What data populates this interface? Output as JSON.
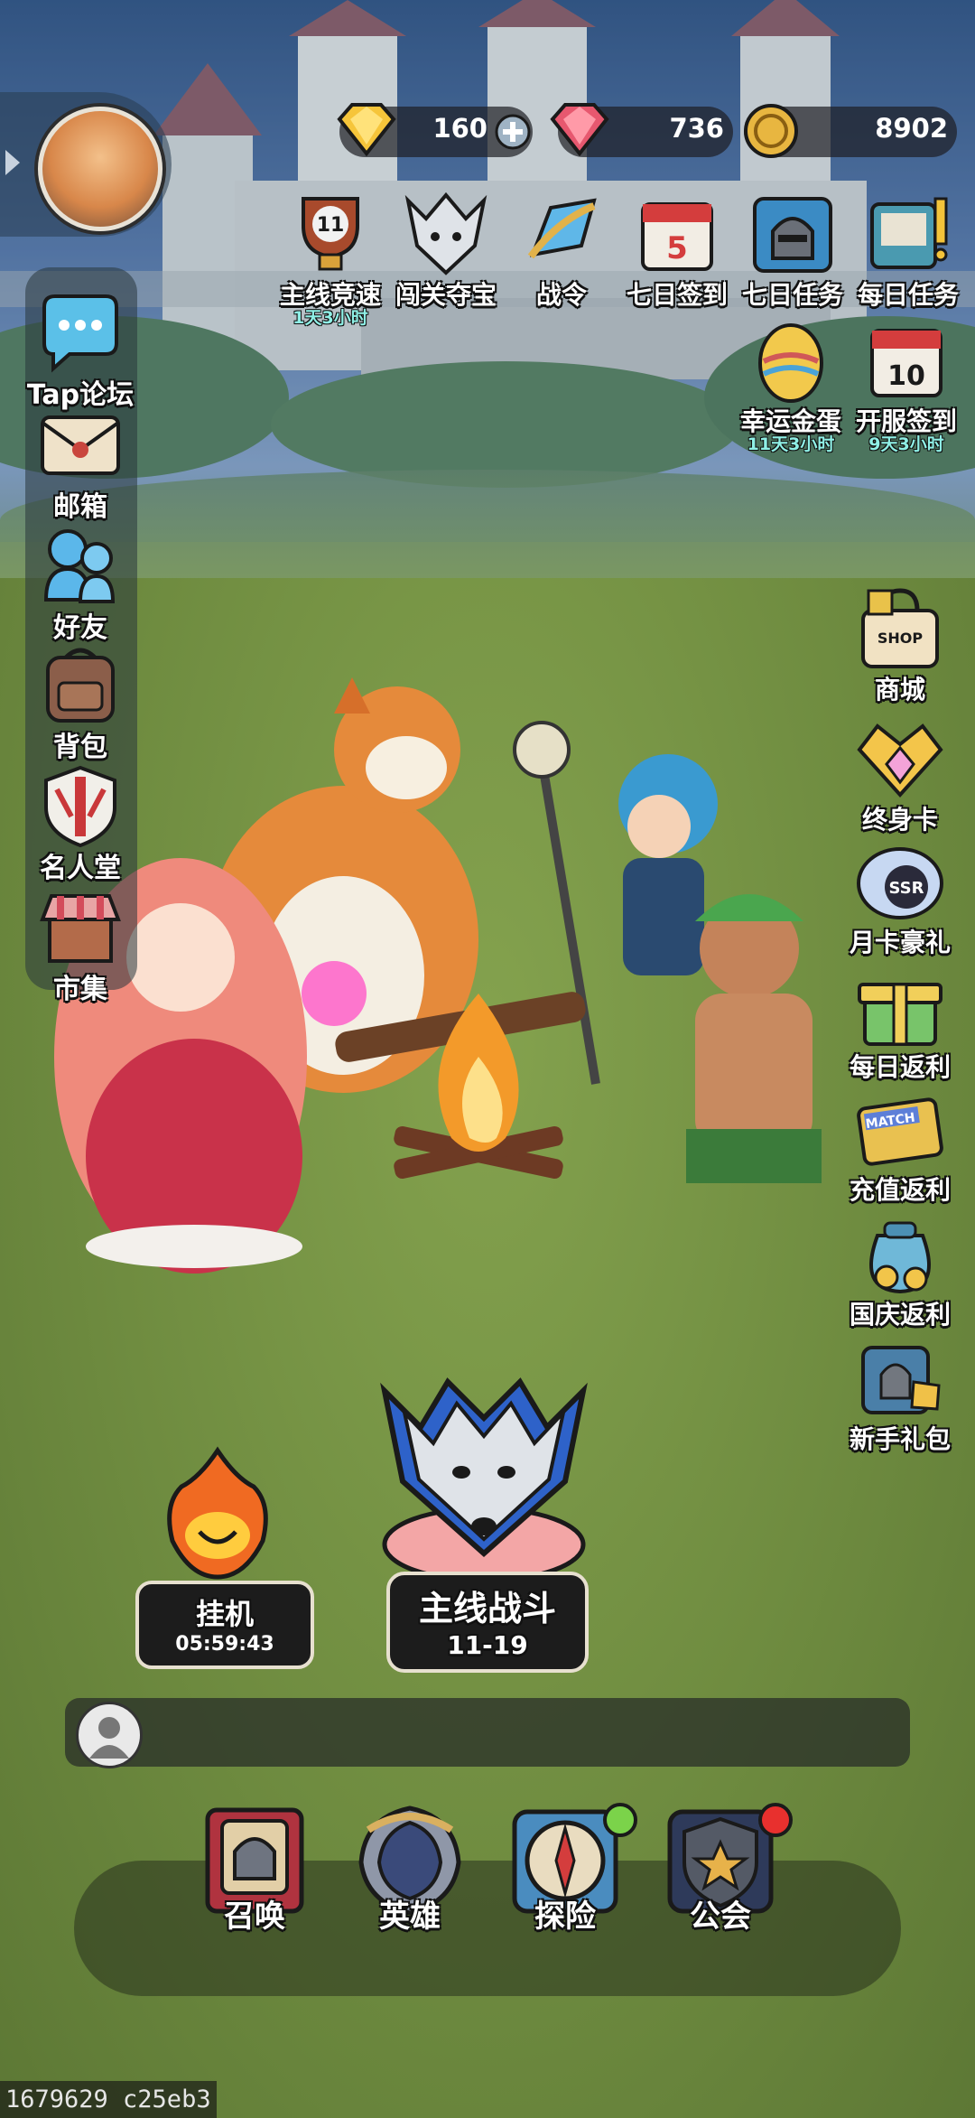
{
  "currencies": {
    "gold_gem": "160",
    "pink_gem": "736",
    "coin": "8902"
  },
  "top_events": [
    {
      "label": "主线竞速",
      "sub": "1天3小时",
      "badge": "11"
    },
    {
      "label": "闯关夺宝",
      "sub": ""
    },
    {
      "label": "战令",
      "sub": ""
    },
    {
      "label": "七日签到",
      "sub": "",
      "badge": "5"
    },
    {
      "label": "七日任务",
      "sub": ""
    },
    {
      "label": "每日任务",
      "sub": ""
    },
    {
      "label": "幸运金蛋",
      "sub": "11天3小时"
    },
    {
      "label": "开服签到",
      "sub": "9天3小时",
      "badge": "10"
    }
  ],
  "left_menu": [
    {
      "label": "Tap论坛"
    },
    {
      "label": "邮箱"
    },
    {
      "label": "好友"
    },
    {
      "label": "背包"
    },
    {
      "label": "名人堂"
    },
    {
      "label": "市集"
    }
  ],
  "right_menu": [
    {
      "label": "商城",
      "tag": "SHOP"
    },
    {
      "label": "终身卡"
    },
    {
      "label": "月卡豪礼",
      "tag": "SSR"
    },
    {
      "label": "每日返利"
    },
    {
      "label": "充值返利",
      "tag": "MATCH"
    },
    {
      "label": "国庆返利"
    },
    {
      "label": "新手礼包"
    }
  ],
  "idle": {
    "label": "挂机",
    "timer": "05:59:43"
  },
  "main_battle": {
    "label": "主线战斗",
    "stage": "11-19"
  },
  "bottom_nav": [
    {
      "label": "召唤"
    },
    {
      "label": "英雄"
    },
    {
      "label": "探险"
    },
    {
      "label": "公会"
    }
  ],
  "colors": {
    "dot_green": "#7bd34a",
    "dot_red": "#e8302e",
    "timer_cyan": "#8ff0e6"
  },
  "build_info": "1679629 c25eb3"
}
